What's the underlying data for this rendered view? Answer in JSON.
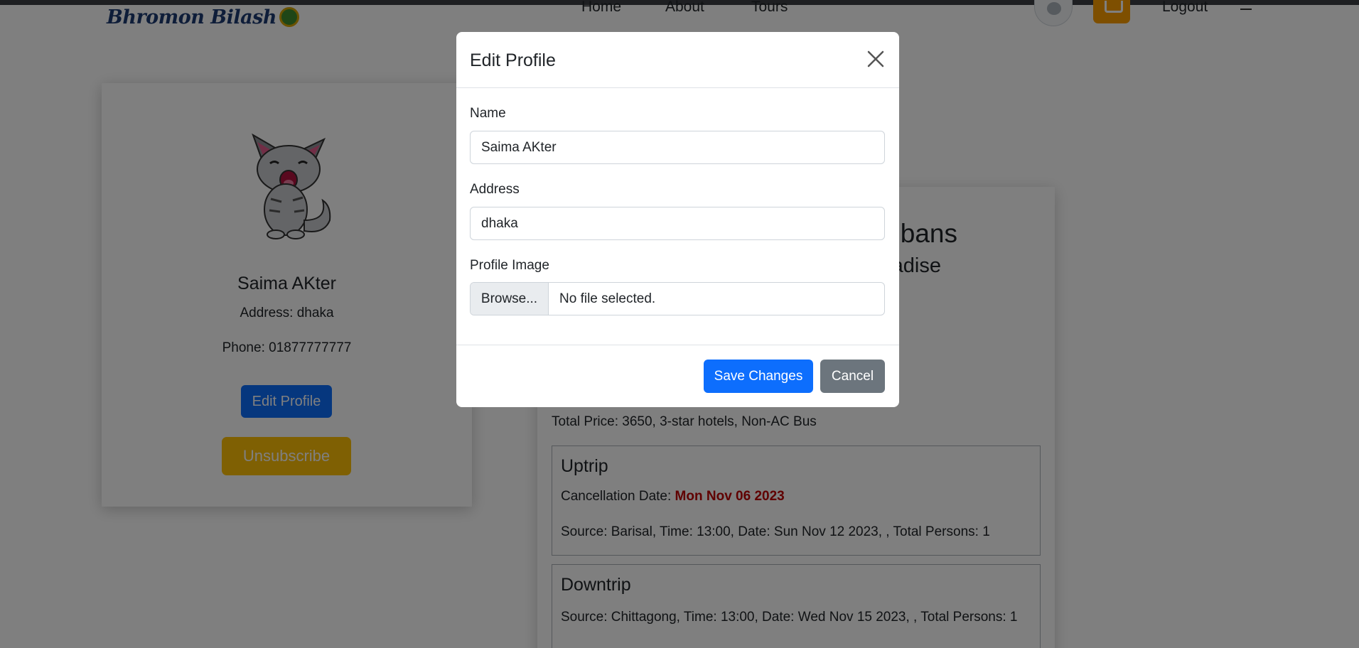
{
  "navbar": {
    "brand": "Bhromon Bilash",
    "links": [
      "Home",
      "About",
      "Tours"
    ],
    "logout": "Logout"
  },
  "profile": {
    "name": "Saima AKter",
    "address": "Address: dhaka",
    "phone": "Phone: 01877777777",
    "edit_label": "Edit Profile",
    "unsubscribe_label": "Unsubscribe"
  },
  "tour": {
    "title_fragment": "bans",
    "subtitle_fragment": "adise",
    "price_line": "Total Price: 3650, 3-star hotels, Non-AC Bus",
    "uptrip": {
      "title": "Uptrip",
      "cancellation_label": "Cancellation Date: ",
      "cancellation_date": "Mon Nov 06 2023",
      "details": "Source: Barisal, Time: 13:00, Date: Sun Nov 12 2023, , Total Persons: 1"
    },
    "downtrip": {
      "title": "Downtrip",
      "details": "Source: Chittagong, Time: 13:00, Date: Wed Nov 15 2023, , Total Persons: 1"
    }
  },
  "modal": {
    "title": "Edit Profile",
    "name_label": "Name",
    "name_value": "Saima AKter",
    "address_label": "Address",
    "address_value": "dhaka",
    "image_label": "Profile Image",
    "browse_label": "Browse...",
    "file_status": "No file selected.",
    "save_label": "Save Changes",
    "cancel_label": "Cancel"
  },
  "colors": {
    "primary": "#0d6efd",
    "warning": "#ffc107",
    "secondary": "#6c757d",
    "danger_text": "#c00000"
  }
}
